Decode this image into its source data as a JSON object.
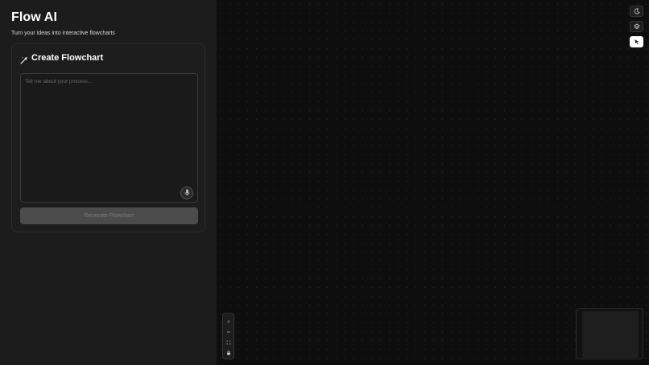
{
  "app": {
    "title": "Flow AI",
    "subtitle": "Turn your ideas into interactive flowcharts"
  },
  "card": {
    "title": "Create Flowchart",
    "icon": "magic-wand-icon"
  },
  "prompt": {
    "value": "",
    "placeholder": "Tell me about your process..."
  },
  "actions": {
    "generate_label": "Generate Flowchart",
    "mic_icon": "microphone-icon"
  },
  "toolbar": {
    "icons": [
      "theme-toggle-icon",
      "layers-icon",
      "cursor-pointer-icon"
    ],
    "active_index": 2
  },
  "canvas_controls": {
    "icons": [
      "zoom-in-icon",
      "zoom-out-icon",
      "fit-view-icon",
      "lock-icon"
    ]
  },
  "colors": {
    "sidebar_bg": "#1c1c1c",
    "canvas_bg": "#0e0e0e",
    "button_disabled": "#4b4b4b",
    "active_tool": "#ffffff"
  }
}
